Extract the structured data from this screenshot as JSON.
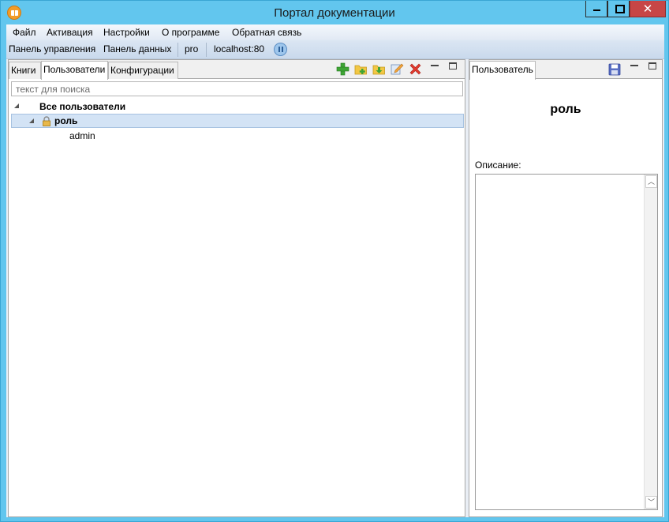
{
  "window": {
    "title": "Портал документации"
  },
  "menu": [
    "Файл",
    "Активация",
    "Настройки",
    "О программе",
    "Обратная связь"
  ],
  "toolbar": {
    "control_panel": "Панель управления",
    "data_panel": "Панель данных",
    "user": "pro",
    "server": "localhost:80"
  },
  "left_panel": {
    "tabs": [
      "Книги",
      "Пользователи",
      "Конфигурации"
    ],
    "active_tab": "Пользователи",
    "search_placeholder": "текст для поиска",
    "tree": {
      "root": "Все пользователи",
      "role": "роль",
      "user": "admin"
    }
  },
  "right_panel": {
    "tab": "Пользователь",
    "role_title": "роль",
    "description_label": "Описание:",
    "description_value": ""
  },
  "icons": [
    "app-icon",
    "pause-icon",
    "add-icon",
    "add-folder-icon",
    "import-icon",
    "edit-icon",
    "delete-icon",
    "lock-icon",
    "save-icon"
  ]
}
